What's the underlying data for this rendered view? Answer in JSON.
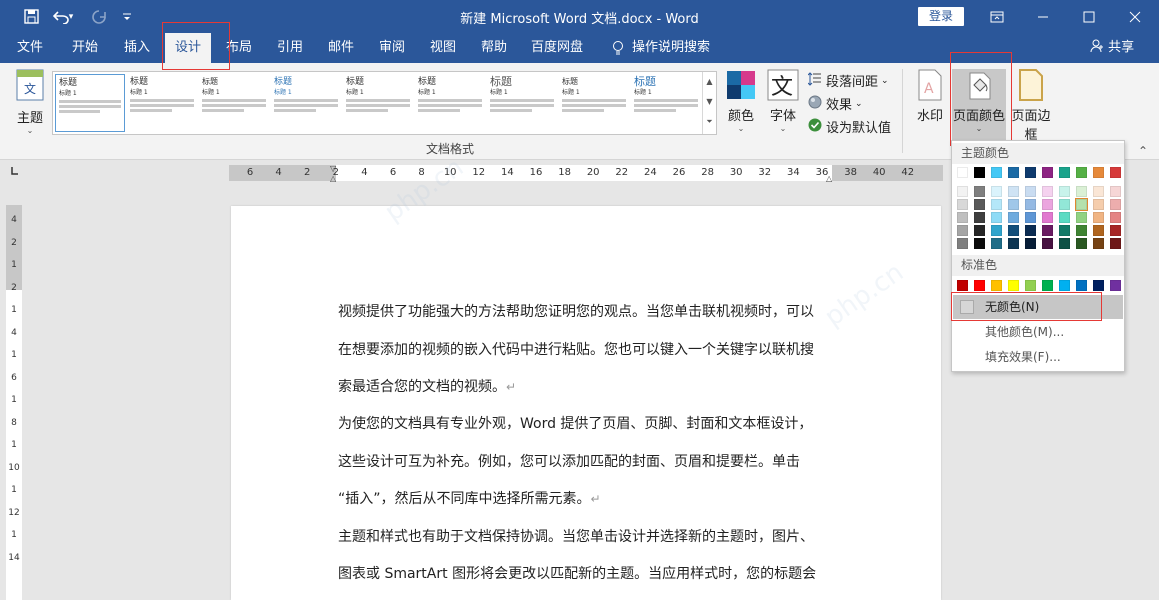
{
  "titlebar": {
    "title": "新建 Microsoft Word 文档.docx  -  Word",
    "login": "登录",
    "qat_icons": [
      "save-icon",
      "undo-icon",
      "redo-icon",
      "customize-icon"
    ]
  },
  "tabs": [
    "文件",
    "开始",
    "插入",
    "设计",
    "布局",
    "引用",
    "邮件",
    "审阅",
    "视图",
    "帮助",
    "百度网盘",
    "操作说明搜索"
  ],
  "active_tab": "设计",
  "share": "共享",
  "ribbon": {
    "theme": "主题",
    "gallery_titles": [
      "标题",
      "标题",
      "标题",
      "标题",
      "标题",
      "标题",
      "标题",
      "标题",
      "标题"
    ],
    "gallery_h1": "标题 1",
    "colors": "颜色",
    "fonts": "字体",
    "paragraph_spacing": "段落间距",
    "effects": "效果",
    "set_default": "设为默认值",
    "watermark": "水印",
    "page_color": "页面颜色",
    "page_border": "页面边框",
    "group_label": "文档格式"
  },
  "ruler": {
    "h_ticks": [
      "6",
      "4",
      "2",
      "2",
      "4",
      "6",
      "8",
      "10",
      "12",
      "14",
      "16",
      "18",
      "20",
      "22",
      "24",
      "26",
      "28",
      "30",
      "32",
      "34",
      "36",
      "38",
      "40",
      "42"
    ],
    "v_ticks": [
      "4",
      "2",
      "1",
      "2",
      "1",
      "4",
      "1",
      "6",
      "1",
      "8",
      "1",
      "10",
      "1",
      "12",
      "1",
      "14"
    ]
  },
  "document": {
    "paragraphs": [
      "视频提供了功能强大的方法帮助您证明您的观点。当您单击联机视频时，可以",
      "在想要添加的视频的嵌入代码中进行粘贴。您也可以键入一个关键字以联机搜",
      "索最适合您的文档的视频。",
      "为使您的文档具有专业外观，Word 提供了页眉、页脚、封面和文本框设计，",
      "这些设计可互为补充。例如，您可以添加匹配的封面、页眉和提要栏。单击",
      "“插入”，然后从不同库中选择所需元素。",
      "主题和样式也有助于文档保持协调。当您单击设计并选择新的主题时，图片、",
      "图表或 SmartArt 图形将会更改以匹配新的主题。当应用样式时，您的标题会"
    ],
    "para_mark": "↵"
  },
  "dropdown": {
    "theme_colors_label": "主题颜色",
    "standard_colors_label": "标准色",
    "no_color": "无颜色(N)",
    "more_colors": "其他颜色(M)...",
    "fill_effects": "填充效果(F)...",
    "theme_top_row": [
      "#ffffff",
      "#000000",
      "#44c8f5",
      "#1b6aa5",
      "#0f3b6e",
      "#8e2483",
      "#1aa38b",
      "#55b045",
      "#e6893a",
      "#d63a3a"
    ],
    "theme_columns": [
      [
        "#f2f2f2",
        "#d8d8d8",
        "#bfbfbf",
        "#a5a5a5",
        "#7f7f7f"
      ],
      [
        "#7f7f7f",
        "#595959",
        "#3f3f3f",
        "#262626",
        "#0c0c0c"
      ],
      [
        "#daf3fc",
        "#b4e7f9",
        "#8fdbf6",
        "#2fa4cc",
        "#1f6d88"
      ],
      [
        "#cfe3f4",
        "#9fc7e9",
        "#6fabde",
        "#134f7b",
        "#0d3552"
      ],
      [
        "#c9dcf1",
        "#94b9e3",
        "#5e96d5",
        "#0b2c52",
        "#071d37"
      ],
      [
        "#f5d2ef",
        "#eba5df",
        "#e179cf",
        "#6a1b62",
        "#471241"
      ],
      [
        "#c8f3eb",
        "#92e7d7",
        "#5bdbc3",
        "#137a68",
        "#0d5145"
      ],
      [
        "#daf0d5",
        "#b5e1ac",
        "#91d282",
        "#3f8433",
        "#2a5822"
      ],
      [
        "#fae6d6",
        "#f5cdac",
        "#f0b483",
        "#b0651f",
        "#764314"
      ],
      [
        "#f6d6d6",
        "#edadad",
        "#e48484",
        "#a72525",
        "#6f1818"
      ]
    ],
    "standard": [
      "#c00000",
      "#ff0000",
      "#ffc000",
      "#ffff00",
      "#92d050",
      "#00b050",
      "#00b0f0",
      "#0070c0",
      "#002060",
      "#7030a0"
    ],
    "selected_swatch": "#b5e1ac"
  },
  "watermark_text": "php.cn"
}
